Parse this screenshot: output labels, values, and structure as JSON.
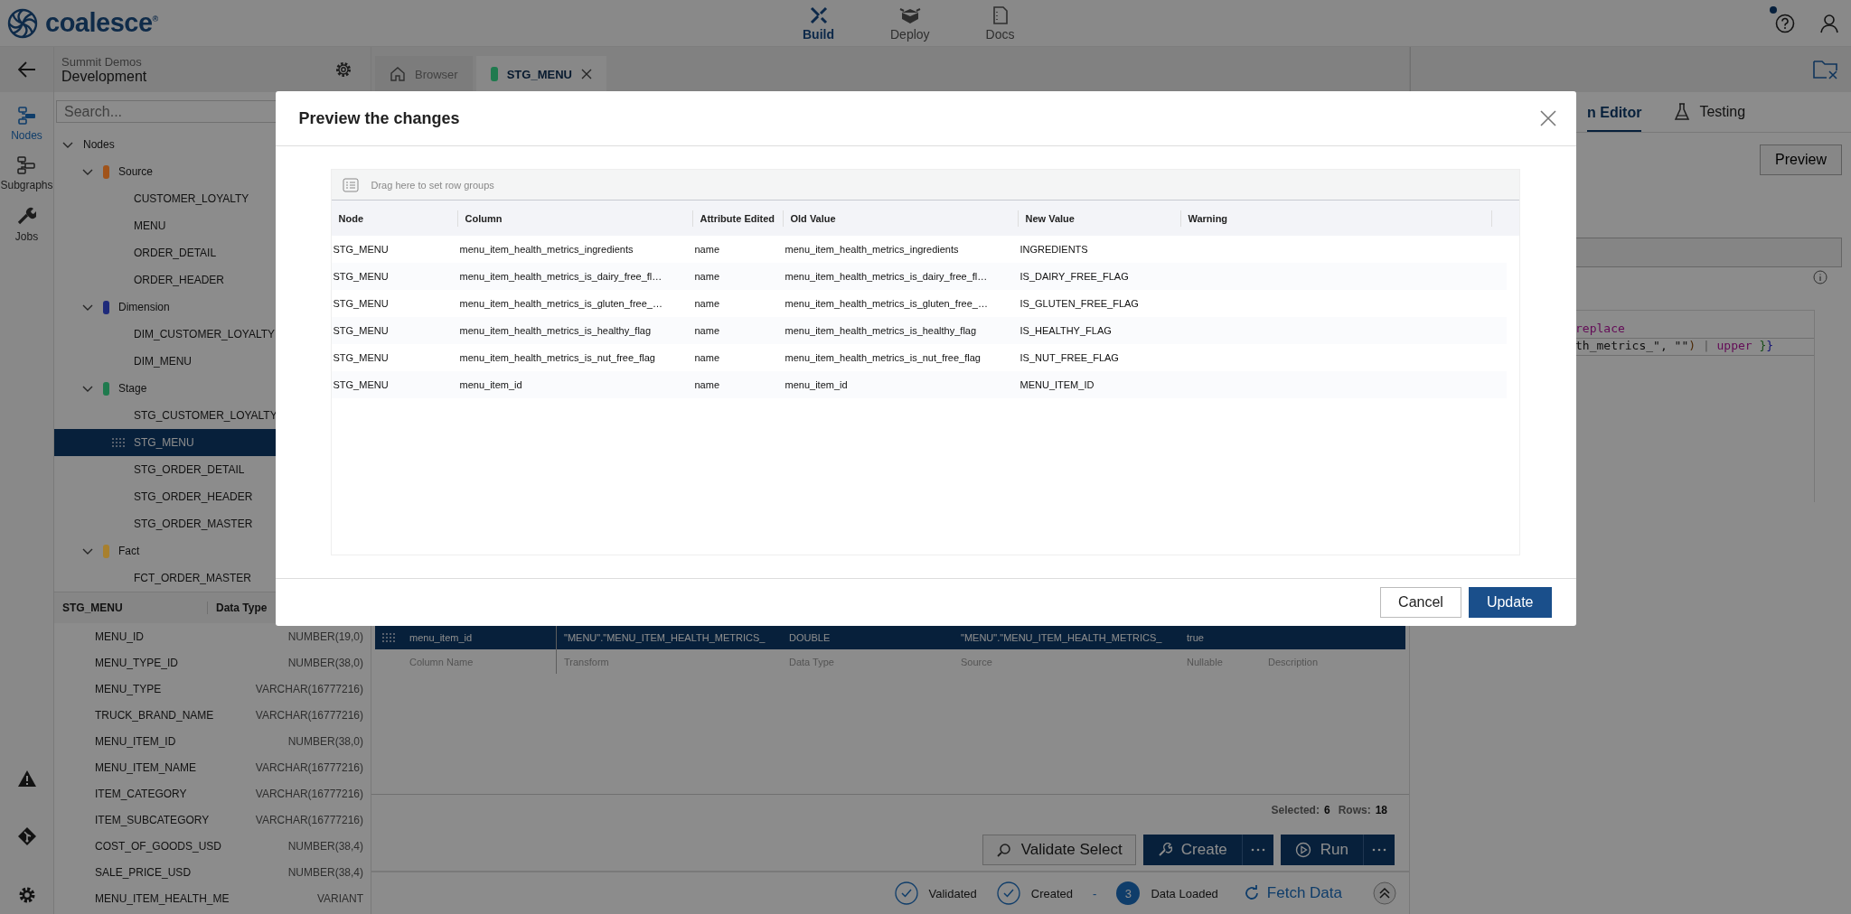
{
  "app": {
    "logo": "coalesce$^{®}$",
    "help_notification": true
  },
  "top_nav": [
    {
      "label": "Build",
      "selected": true,
      "kind": "build"
    },
    {
      "label": "Deploy",
      "selected": false,
      "kind": "deploy"
    },
    {
      "label": "Docs",
      "selected": false,
      "kind": "docs"
    }
  ],
  "workspace": {
    "project": "Summit Demos",
    "environment": "Development"
  },
  "rail": [
    {
      "label": "Nodes",
      "selected": true,
      "kind": "nodes"
    },
    {
      "label": "Subgraphs",
      "selected": false,
      "kind": "subgraphs"
    },
    {
      "label": "Jobs",
      "selected": false,
      "kind": "jobs"
    }
  ],
  "search": {
    "placeholder": "Search..."
  },
  "tree": {
    "label": "Nodes",
    "expanded": true,
    "selected": false,
    "children": [
      {
        "label": "Source",
        "color": "#a0531a",
        "expanded": true,
        "selected": false,
        "children": [
          {
            "label": "CUSTOMER_LOYALTY",
            "selected": false
          },
          {
            "label": "MENU",
            "selected": false
          },
          {
            "label": "ORDER_DETAIL",
            "selected": false
          },
          {
            "label": "ORDER_HEADER",
            "selected": false
          }
        ]
      },
      {
        "label": "Dimension",
        "color": "#1e2a7a",
        "expanded": true,
        "selected": false,
        "children": [
          {
            "label": "DIM_CUSTOMER_LOYALTY",
            "selected": false
          },
          {
            "label": "DIM_MENU",
            "selected": false
          }
        ]
      },
      {
        "label": "Stage",
        "color": "#1f7a4e",
        "expanded": true,
        "selected": false,
        "children": [
          {
            "label": "STG_CUSTOMER_LOYALTY",
            "selected": false
          },
          {
            "label": "STG_MENU",
            "selected": true
          },
          {
            "label": "STG_ORDER_DETAIL",
            "selected": false
          },
          {
            "label": "STG_ORDER_HEADER",
            "selected": false
          },
          {
            "label": "STG_ORDER_MASTER",
            "selected": false
          }
        ]
      },
      {
        "label": "Fact",
        "color": "#a8802e",
        "expanded": true,
        "selected": false,
        "children": [
          {
            "label": "FCT_ORDER_MASTER",
            "selected": false
          }
        ]
      }
    ]
  },
  "column_list": {
    "header": [
      "STG_MENU",
      "Data Type"
    ],
    "rows": [
      {
        "name": "MENU_ID",
        "type": "NUMBER(19,0)"
      },
      {
        "name": "MENU_TYPE_ID",
        "type": "NUMBER(38,0)"
      },
      {
        "name": "MENU_TYPE",
        "type": "VARCHAR(16777216)"
      },
      {
        "name": "TRUCK_BRAND_NAME",
        "type": "VARCHAR(16777216)"
      },
      {
        "name": "MENU_ITEM_ID",
        "type": "NUMBER(38,0)"
      },
      {
        "name": "MENU_ITEM_NAME",
        "type": "VARCHAR(16777216)"
      },
      {
        "name": "ITEM_CATEGORY",
        "type": "VARCHAR(16777216)"
      },
      {
        "name": "ITEM_SUBCATEGORY",
        "type": "VARCHAR(16777216)"
      },
      {
        "name": "COST_OF_GOODS_USD",
        "type": "NUMBER(38,4)"
      },
      {
        "name": "SALE_PRICE_USD",
        "type": "NUMBER(38,4)"
      },
      {
        "name": "MENU_ITEM_HEALTH_ME",
        "type": "VARIANT"
      }
    ]
  },
  "tabs": [
    {
      "label": "Browser",
      "selected": false,
      "kind": "browser"
    },
    {
      "label": "STG_MENU",
      "selected": true,
      "kind": "node",
      "color": "#1f7a4e"
    }
  ],
  "column_grid": {
    "rows": [
      {
        "selected": true,
        "cells": [
          "menu_item_id",
          "\"MENU\".\"MENU_ITEM_HEALTH_METRICS_",
          "DOUBLE",
          "\"MENU\".\"MENU_ITEM_HEALTH_METRICS_",
          "true"
        ]
      }
    ],
    "placeholders": [
      "Column Name",
      "Transform",
      "Data Type",
      "Source",
      "Nullable",
      "Description"
    ]
  },
  "grid_footer": {
    "selected_label": "Selected:",
    "selected": "6",
    "rows_label": "Rows:",
    "rows": "18"
  },
  "actions": [
    {
      "label": "Validate Select",
      "kind": "outline"
    },
    {
      "label": "Create",
      "kind": "split"
    },
    {
      "label": "Run",
      "kind": "split"
    }
  ],
  "status": [
    {
      "label": "Validated",
      "kind": "check"
    },
    {
      "label": "Created",
      "kind": "check"
    },
    {
      "label": "-",
      "kind": "separator"
    },
    {
      "label": "Data Loaded",
      "kind": "count",
      "count": "3"
    }
  ],
  "fetch": {
    "label": "Fetch Data"
  },
  "right_panel": {
    "tabs": [
      {
        "label": "n Editor",
        "selected": true
      },
      {
        "label": "Testing",
        "selected": false
      }
    ],
    "preview_button": "Preview",
    "code_lines": [
      [
        {
          "text": "replace",
          "kind": "keyword"
        }
      ],
      [
        {
          "text": "th_metrics_\", \"\"",
          "kind": "plain"
        },
        {
          "text": ")",
          "kind": "paren"
        },
        {
          "text": " | ",
          "kind": "pipe"
        },
        {
          "text": "upper",
          "kind": "keyword"
        },
        {
          "text": " }",
          "kind": "brace_open"
        },
        {
          "text": "}",
          "kind": "brace_close"
        }
      ]
    ]
  },
  "modal": {
    "title": "Preview the changes",
    "group_hint": "Drag here to set row groups",
    "columns": [
      "Node",
      "Column",
      "Attribute Edited",
      "Old Value",
      "New Value",
      "Warning"
    ],
    "rows": [
      [
        "STG_MENU",
        "menu_item_health_metrics_ingredients",
        "name",
        "menu_item_health_metrics_ingredients",
        "INGREDIENTS",
        ""
      ],
      [
        "STG_MENU",
        "menu_item_health_metrics_is_dairy_free_fl…",
        "name",
        "menu_item_health_metrics_is_dairy_free_fl…",
        "IS_DAIRY_FREE_FLAG",
        ""
      ],
      [
        "STG_MENU",
        "menu_item_health_metrics_is_gluten_free_…",
        "name",
        "menu_item_health_metrics_is_gluten_free_…",
        "IS_GLUTEN_FREE_FLAG",
        ""
      ],
      [
        "STG_MENU",
        "menu_item_health_metrics_is_healthy_flag",
        "name",
        "menu_item_health_metrics_is_healthy_flag",
        "IS_HEALTHY_FLAG",
        ""
      ],
      [
        "STG_MENU",
        "menu_item_health_metrics_is_nut_free_flag",
        "name",
        "menu_item_health_metrics_is_nut_free_flag",
        "IS_NUT_FREE_FLAG",
        ""
      ],
      [
        "STG_MENU",
        "menu_item_id",
        "name",
        "menu_item_id",
        "MENU_ITEM_ID",
        ""
      ]
    ],
    "buttons": [
      {
        "label": "Cancel",
        "kind": "secondary"
      },
      {
        "label": "Update",
        "kind": "primary"
      }
    ]
  }
}
